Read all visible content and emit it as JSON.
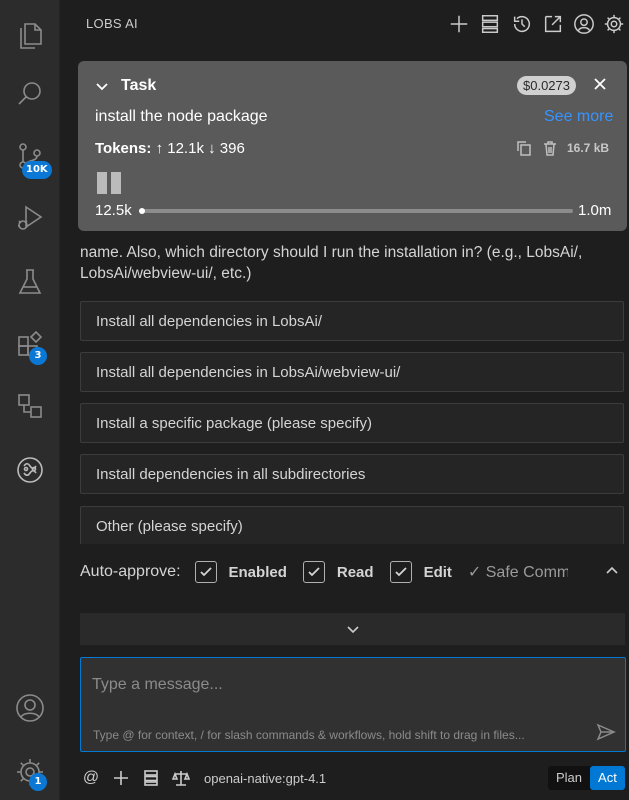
{
  "activity_bar": {
    "items": [
      {
        "name": "explorer",
        "icon": "files-icon"
      },
      {
        "name": "search",
        "icon": "search-icon"
      },
      {
        "name": "source-control",
        "icon": "source-control-icon",
        "badge": "10K"
      },
      {
        "name": "run-debug",
        "icon": "debug-icon"
      },
      {
        "name": "testing",
        "icon": "flask-icon"
      },
      {
        "name": "extensions",
        "icon": "extensions-icon",
        "badge": "3"
      },
      {
        "name": "remote-explorer",
        "icon": "remote-icon"
      },
      {
        "name": "lobs-ai",
        "icon": "lobs-ai-logo-icon"
      }
    ],
    "bottom": [
      {
        "name": "accounts",
        "icon": "account-icon"
      },
      {
        "name": "manage",
        "icon": "gear-icon",
        "badge": "1"
      }
    ]
  },
  "header": {
    "title": "LOBS AI"
  },
  "task": {
    "label": "Task",
    "cost": "$0.0273",
    "text": "install the node package",
    "see_more": "See more",
    "tokens_label": "Tokens:",
    "tokens_up": "12.1k",
    "tokens_down": "396",
    "size": "16.7 kB",
    "context_used": "12.5k",
    "context_max": "1.0m",
    "context_fraction": 0.0125
  },
  "chat": {
    "message": "name. Also, which directory should I run the installation in? (e.g., LobsAi/, LobsAi/webview-ui/, etc.)"
  },
  "options": [
    "Install all dependencies in LobsAi/",
    "Install all dependencies in LobsAi/webview-ui/",
    "Install a specific package (please specify)",
    "Install dependencies in all subdirectories",
    "Other (please specify)"
  ],
  "auto_approve": {
    "label": "Auto-approve:",
    "enabled": "Enabled",
    "read": "Read",
    "edit": "Edit",
    "safe_commands": "✓ Safe Comman"
  },
  "input": {
    "placeholder": "Type a message...",
    "hint": "Type @ for context, / for slash commands & workflows, hold shift to drag in files..."
  },
  "bottom_bar": {
    "at": "@",
    "model": "openai-native:gpt-4.1",
    "plan": "Plan",
    "act": "Act"
  },
  "colors": {
    "accent": "#0078d4",
    "link": "#3794ff",
    "badge": "#0a78d4"
  }
}
